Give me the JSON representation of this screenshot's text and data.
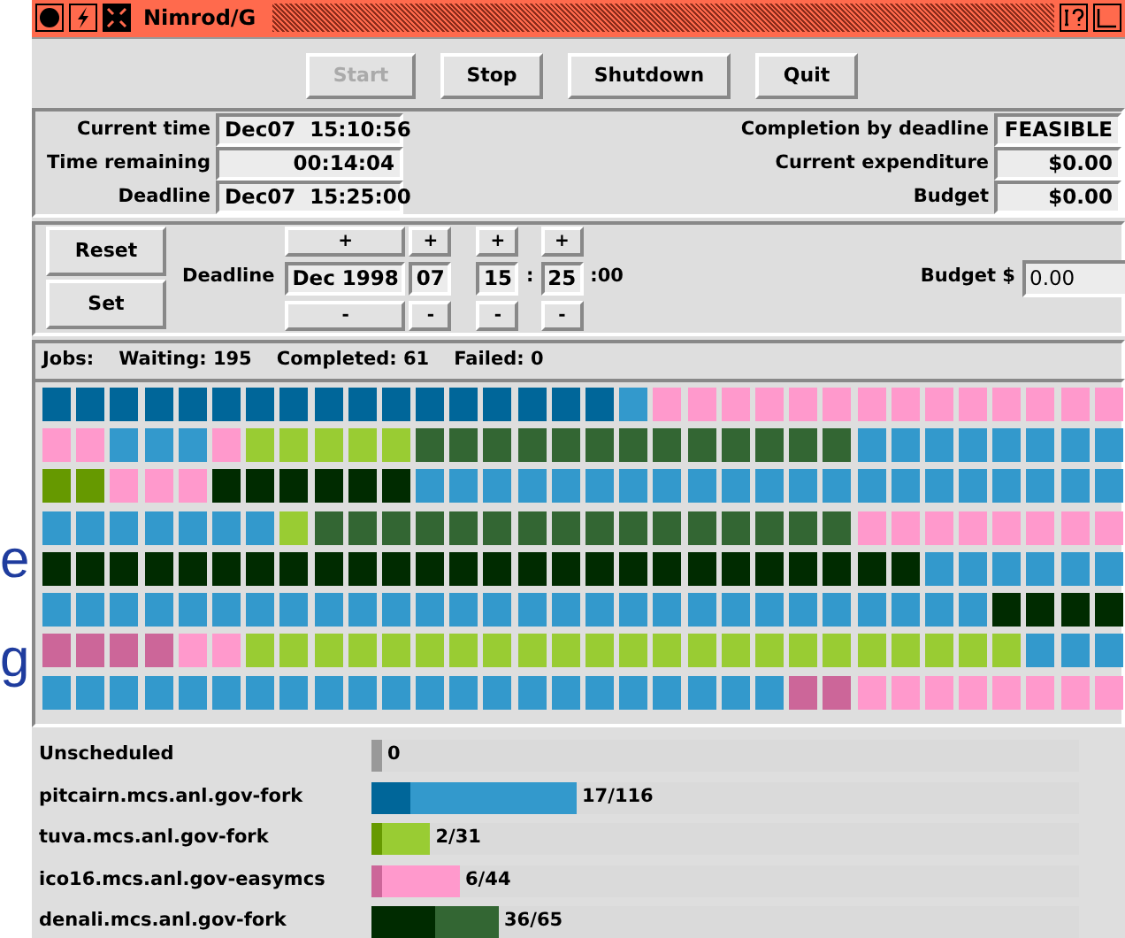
{
  "backdrop_text": [
    "e",
    "g"
  ],
  "window": {
    "title": "Nimrod/G"
  },
  "toolbar": [
    {
      "label": "Start",
      "disabled": true
    },
    {
      "label": "Stop",
      "disabled": false
    },
    {
      "label": "Shutdown",
      "disabled": false
    },
    {
      "label": "Quit",
      "disabled": false
    }
  ],
  "status_left": [
    {
      "label": "Current time",
      "value": "Dec07  15:10:56"
    },
    {
      "label": "Time remaining",
      "value": "00:14:04"
    },
    {
      "label": "Deadline",
      "value": "Dec07  15:25:00"
    }
  ],
  "status_right": [
    {
      "label": "Completion by deadline",
      "value": "FEASIBLE"
    },
    {
      "label": "Current expenditure",
      "value": "$0.00"
    },
    {
      "label": "Budget",
      "value": "$0.00"
    }
  ],
  "controls": {
    "buttons": [
      "Reset",
      "Set"
    ],
    "deadline_label": "Deadline",
    "spinners": [
      {
        "kind": "spin",
        "value": "Dec 1998",
        "up": "+",
        "down": "-"
      },
      {
        "kind": "spin",
        "value": "07",
        "up": "+",
        "down": "-"
      },
      {
        "kind": "spin",
        "value": "15",
        "up": "+",
        "down": "-"
      },
      {
        "kind": "text",
        "value": ":"
      },
      {
        "kind": "spin",
        "value": "25",
        "up": "+",
        "down": "-"
      },
      {
        "kind": "text",
        "value": ":00"
      }
    ],
    "budget_label": "Budget $",
    "budget_value": "0.00"
  },
  "jobs_summary": [
    "Jobs:",
    "Waiting: 195",
    "Completed: 61",
    "Failed: 0"
  ],
  "job_grid": [
    [
      {
        "color": "#006699"
      },
      {
        "color": "#006699"
      },
      {
        "color": "#006699"
      },
      {
        "color": "#006699"
      },
      {
        "color": "#006699"
      },
      {
        "color": "#006699"
      },
      {
        "color": "#006699"
      },
      {
        "color": "#006699"
      },
      {
        "color": "#006699"
      },
      {
        "color": "#006699"
      },
      {
        "color": "#006699"
      },
      {
        "color": "#006699"
      },
      {
        "color": "#006699"
      },
      {
        "color": "#006699"
      },
      {
        "color": "#006699"
      },
      {
        "color": "#006699"
      },
      {
        "color": "#006699"
      },
      {
        "color": "#3399cc"
      },
      {
        "color": "#ff99cc"
      },
      {
        "color": "#ff99cc"
      },
      {
        "color": "#ff99cc"
      },
      {
        "color": "#ff99cc"
      },
      {
        "color": "#ff99cc"
      },
      {
        "color": "#ff99cc"
      },
      {
        "color": "#ff99cc"
      },
      {
        "color": "#ff99cc"
      },
      {
        "color": "#ff99cc"
      },
      {
        "color": "#ff99cc"
      },
      {
        "color": "#ff99cc"
      },
      {
        "color": "#ff99cc"
      },
      {
        "color": "#ff99cc"
      },
      {
        "color": "#ff99cc"
      }
    ],
    [
      {
        "color": "#ff99cc"
      },
      {
        "color": "#ff99cc"
      },
      {
        "color": "#3399cc"
      },
      {
        "color": "#3399cc"
      },
      {
        "color": "#3399cc"
      },
      {
        "color": "#ff99cc"
      },
      {
        "color": "#99cc33"
      },
      {
        "color": "#99cc33"
      },
      {
        "color": "#99cc33"
      },
      {
        "color": "#99cc33"
      },
      {
        "color": "#99cc33"
      },
      {
        "color": "#336633"
      },
      {
        "color": "#336633"
      },
      {
        "color": "#336633"
      },
      {
        "color": "#336633"
      },
      {
        "color": "#336633"
      },
      {
        "color": "#336633"
      },
      {
        "color": "#336633"
      },
      {
        "color": "#336633"
      },
      {
        "color": "#336633"
      },
      {
        "color": "#336633"
      },
      {
        "color": "#336633"
      },
      {
        "color": "#336633"
      },
      {
        "color": "#336633"
      },
      {
        "color": "#3399cc"
      },
      {
        "color": "#3399cc"
      },
      {
        "color": "#3399cc"
      },
      {
        "color": "#3399cc"
      },
      {
        "color": "#3399cc"
      },
      {
        "color": "#3399cc"
      },
      {
        "color": "#3399cc"
      },
      {
        "color": "#3399cc"
      }
    ],
    [
      {
        "color": "#669900"
      },
      {
        "color": "#669900"
      },
      {
        "color": "#ff99cc"
      },
      {
        "color": "#ff99cc"
      },
      {
        "color": "#ff99cc"
      },
      {
        "color": "#002b00"
      },
      {
        "color": "#002b00"
      },
      {
        "color": "#002b00"
      },
      {
        "color": "#002b00"
      },
      {
        "color": "#002b00"
      },
      {
        "color": "#002b00"
      },
      {
        "color": "#3399cc"
      },
      {
        "color": "#3399cc"
      },
      {
        "color": "#3399cc"
      },
      {
        "color": "#3399cc"
      },
      {
        "color": "#3399cc"
      },
      {
        "color": "#3399cc"
      },
      {
        "color": "#3399cc"
      },
      {
        "color": "#3399cc"
      },
      {
        "color": "#3399cc"
      },
      {
        "color": "#3399cc"
      },
      {
        "color": "#3399cc"
      },
      {
        "color": "#3399cc"
      },
      {
        "color": "#3399cc"
      },
      {
        "color": "#3399cc"
      },
      {
        "color": "#3399cc"
      },
      {
        "color": "#3399cc"
      },
      {
        "color": "#3399cc"
      },
      {
        "color": "#3399cc"
      },
      {
        "color": "#3399cc"
      },
      {
        "color": "#3399cc"
      },
      {
        "color": "#3399cc"
      }
    ],
    [
      {
        "color": "#3399cc"
      },
      {
        "color": "#3399cc"
      },
      {
        "color": "#3399cc"
      },
      {
        "color": "#3399cc"
      },
      {
        "color": "#3399cc"
      },
      {
        "color": "#3399cc"
      },
      {
        "color": "#3399cc"
      },
      {
        "color": "#99cc33"
      },
      {
        "color": "#336633"
      },
      {
        "color": "#336633"
      },
      {
        "color": "#336633"
      },
      {
        "color": "#336633"
      },
      {
        "color": "#336633"
      },
      {
        "color": "#336633"
      },
      {
        "color": "#336633"
      },
      {
        "color": "#336633"
      },
      {
        "color": "#336633"
      },
      {
        "color": "#336633"
      },
      {
        "color": "#336633"
      },
      {
        "color": "#336633"
      },
      {
        "color": "#336633"
      },
      {
        "color": "#336633"
      },
      {
        "color": "#336633"
      },
      {
        "color": "#336633"
      },
      {
        "color": "#ff99cc"
      },
      {
        "color": "#ff99cc"
      },
      {
        "color": "#ff99cc"
      },
      {
        "color": "#ff99cc"
      },
      {
        "color": "#ff99cc"
      },
      {
        "color": "#ff99cc"
      },
      {
        "color": "#ff99cc"
      },
      {
        "color": "#ff99cc"
      }
    ],
    [
      {
        "color": "#002b00"
      },
      {
        "color": "#002b00"
      },
      {
        "color": "#002b00"
      },
      {
        "color": "#002b00"
      },
      {
        "color": "#002b00"
      },
      {
        "color": "#002b00"
      },
      {
        "color": "#002b00"
      },
      {
        "color": "#002b00"
      },
      {
        "color": "#002b00"
      },
      {
        "color": "#002b00"
      },
      {
        "color": "#002b00"
      },
      {
        "color": "#002b00"
      },
      {
        "color": "#002b00"
      },
      {
        "color": "#002b00"
      },
      {
        "color": "#002b00"
      },
      {
        "color": "#002b00"
      },
      {
        "color": "#002b00"
      },
      {
        "color": "#002b00"
      },
      {
        "color": "#002b00"
      },
      {
        "color": "#002b00"
      },
      {
        "color": "#002b00"
      },
      {
        "color": "#002b00"
      },
      {
        "color": "#002b00"
      },
      {
        "color": "#002b00"
      },
      {
        "color": "#002b00"
      },
      {
        "color": "#002b00"
      },
      {
        "color": "#3399cc"
      },
      {
        "color": "#3399cc"
      },
      {
        "color": "#3399cc"
      },
      {
        "color": "#3399cc"
      },
      {
        "color": "#3399cc"
      },
      {
        "color": "#3399cc"
      }
    ],
    [
      {
        "color": "#3399cc"
      },
      {
        "color": "#3399cc"
      },
      {
        "color": "#3399cc"
      },
      {
        "color": "#3399cc"
      },
      {
        "color": "#3399cc"
      },
      {
        "color": "#3399cc"
      },
      {
        "color": "#3399cc"
      },
      {
        "color": "#3399cc"
      },
      {
        "color": "#3399cc"
      },
      {
        "color": "#3399cc"
      },
      {
        "color": "#3399cc"
      },
      {
        "color": "#3399cc"
      },
      {
        "color": "#3399cc"
      },
      {
        "color": "#3399cc"
      },
      {
        "color": "#3399cc"
      },
      {
        "color": "#3399cc"
      },
      {
        "color": "#3399cc"
      },
      {
        "color": "#3399cc"
      },
      {
        "color": "#3399cc"
      },
      {
        "color": "#3399cc"
      },
      {
        "color": "#3399cc"
      },
      {
        "color": "#3399cc"
      },
      {
        "color": "#3399cc"
      },
      {
        "color": "#3399cc"
      },
      {
        "color": "#3399cc"
      },
      {
        "color": "#3399cc"
      },
      {
        "color": "#3399cc"
      },
      {
        "color": "#3399cc"
      },
      {
        "color": "#002b00"
      },
      {
        "color": "#002b00"
      },
      {
        "color": "#002b00"
      },
      {
        "color": "#002b00"
      }
    ],
    [
      {
        "color": "#cc6699"
      },
      {
        "color": "#cc6699"
      },
      {
        "color": "#cc6699"
      },
      {
        "color": "#cc6699"
      },
      {
        "color": "#ff99cc"
      },
      {
        "color": "#ff99cc"
      },
      {
        "color": "#99cc33"
      },
      {
        "color": "#99cc33"
      },
      {
        "color": "#99cc33"
      },
      {
        "color": "#99cc33"
      },
      {
        "color": "#99cc33"
      },
      {
        "color": "#99cc33"
      },
      {
        "color": "#99cc33"
      },
      {
        "color": "#99cc33"
      },
      {
        "color": "#99cc33"
      },
      {
        "color": "#99cc33"
      },
      {
        "color": "#99cc33"
      },
      {
        "color": "#99cc33"
      },
      {
        "color": "#99cc33"
      },
      {
        "color": "#99cc33"
      },
      {
        "color": "#99cc33"
      },
      {
        "color": "#99cc33"
      },
      {
        "color": "#99cc33"
      },
      {
        "color": "#99cc33"
      },
      {
        "color": "#99cc33"
      },
      {
        "color": "#99cc33"
      },
      {
        "color": "#99cc33"
      },
      {
        "color": "#99cc33"
      },
      {
        "color": "#99cc33"
      },
      {
        "color": "#3399cc"
      },
      {
        "color": "#3399cc"
      },
      {
        "color": "#3399cc"
      }
    ],
    [
      {
        "color": "#3399cc"
      },
      {
        "color": "#3399cc"
      },
      {
        "color": "#3399cc"
      },
      {
        "color": "#3399cc"
      },
      {
        "color": "#3399cc"
      },
      {
        "color": "#3399cc"
      },
      {
        "color": "#3399cc"
      },
      {
        "color": "#3399cc"
      },
      {
        "color": "#3399cc"
      },
      {
        "color": "#3399cc"
      },
      {
        "color": "#3399cc"
      },
      {
        "color": "#3399cc"
      },
      {
        "color": "#3399cc"
      },
      {
        "color": "#3399cc"
      },
      {
        "color": "#3399cc"
      },
      {
        "color": "#3399cc"
      },
      {
        "color": "#3399cc"
      },
      {
        "color": "#3399cc"
      },
      {
        "color": "#3399cc"
      },
      {
        "color": "#3399cc"
      },
      {
        "color": "#3399cc"
      },
      {
        "color": "#3399cc"
      },
      {
        "color": "#cc6699"
      },
      {
        "color": "#cc6699"
      },
      {
        "color": "#ff99cc"
      },
      {
        "color": "#ff99cc"
      },
      {
        "color": "#ff99cc"
      },
      {
        "color": "#ff99cc"
      },
      {
        "color": "#ff99cc"
      },
      {
        "color": "#ff99cc"
      },
      {
        "color": "#ff99cc"
      },
      {
        "color": "#ff99cc"
      }
    ]
  ],
  "resources": [
    {
      "name": "Unscheduled",
      "count": "0",
      "total_bar": {
        "level": 0.015,
        "color": "#999999"
      }
    },
    {
      "name": "pitcairn.mcs.anl.gov-fork",
      "count": "17/116",
      "total_bar": {
        "level": 0.29,
        "color": "#3399cc"
      },
      "done_bar": {
        "level": 0.055,
        "color": "#006699"
      }
    },
    {
      "name": "tuva.mcs.anl.gov-fork",
      "count": "2/31",
      "total_bar": {
        "level": 0.083,
        "color": "#99cc33"
      },
      "done_bar": {
        "level": 0.015,
        "color": "#669900"
      }
    },
    {
      "name": "ico16.mcs.anl.gov-easymcs",
      "count": "6/44",
      "total_bar": {
        "level": 0.125,
        "color": "#ff99cc"
      },
      "done_bar": {
        "level": 0.015,
        "color": "#cc6699"
      }
    },
    {
      "name": "denali.mcs.anl.gov-fork",
      "count": "36/65",
      "total_bar": {
        "level": 0.18,
        "color": "#336633"
      },
      "done_bar": {
        "level": 0.09,
        "color": "#002b00"
      }
    }
  ]
}
